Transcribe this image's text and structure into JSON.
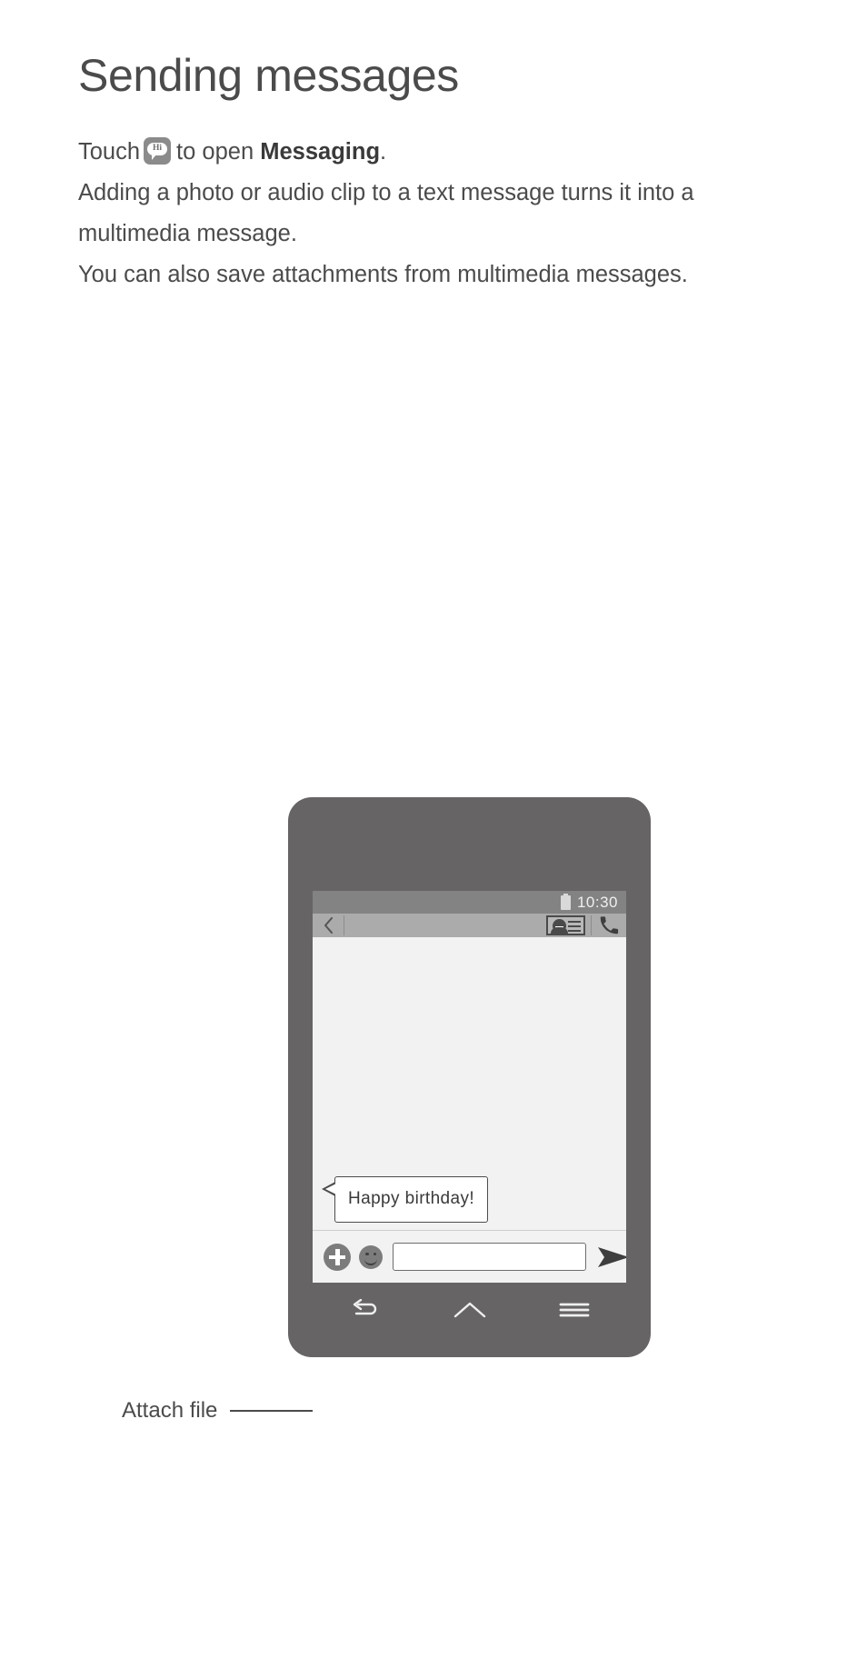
{
  "document": {
    "title": "Sending messages",
    "paragraphs": [
      {
        "prefix": "Touch",
        "icon": "messaging-app-icon",
        "icon_text": "Hi",
        "middle": "to open",
        "bold": "Messaging",
        "suffix": "."
      },
      {
        "text": "Adding a photo or audio clip to a text message turns it into a multimedia message."
      },
      {
        "text": "You can also save attachments from multimedia messages."
      }
    ]
  },
  "phone": {
    "statusbar": {
      "battery_icon": "battery-icon",
      "time": "10:30"
    },
    "appbar": {
      "back_icon": "back-chevron-icon",
      "recipient_value": "",
      "recipient_placeholder": "",
      "contact_icon": "contact-card-icon",
      "call_icon": "phone-call-icon"
    },
    "conversation": {
      "messages": [
        {
          "text": "Happy birthday!",
          "side": "incoming"
        }
      ]
    },
    "compose": {
      "attach_icon": "plus-icon",
      "emoji_icon": "smiley-icon",
      "input_value": "",
      "input_placeholder": "",
      "send_icon": "send-arrow-icon"
    },
    "navbar": {
      "back_icon": "nav-back-icon",
      "home_icon": "nav-home-icon",
      "menu_icon": "nav-menu-icon"
    }
  },
  "callout": {
    "label": "Attach file"
  },
  "colors": {
    "phone_body": "#666464",
    "status_bar": "#838383",
    "app_bar": "#ababab",
    "screen_bg": "#f2f2f2",
    "text": "#4b4b4b"
  }
}
